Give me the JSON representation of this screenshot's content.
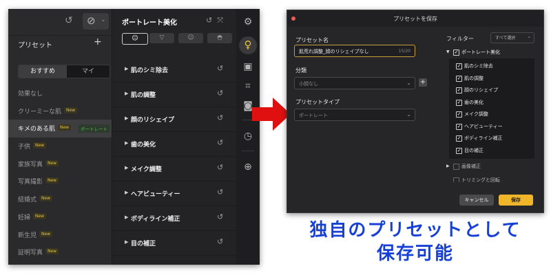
{
  "left_panel": {
    "preset_title": "プリセット",
    "plus": "+",
    "tab_recommended": "おすすめ",
    "tab_mine": "マイ",
    "presets": [
      {
        "label": "効果なし",
        "new": "",
        "tag": ""
      },
      {
        "label": "クリーミーな肌",
        "new": "New",
        "tag": ""
      },
      {
        "label": "キメのある肌",
        "new": "New",
        "tag": "ポートレート"
      },
      {
        "label": "子供",
        "new": "New",
        "tag": ""
      },
      {
        "label": "家族写真",
        "new": "New",
        "tag": ""
      },
      {
        "label": "写真撮影",
        "new": "New",
        "tag": ""
      },
      {
        "label": "結婚式",
        "new": "New",
        "tag": ""
      },
      {
        "label": "妊婦",
        "new": "New",
        "tag": ""
      },
      {
        "label": "新生児",
        "new": "New",
        "tag": ""
      },
      {
        "label": "証明写真",
        "new": "New",
        "tag": ""
      }
    ],
    "selected_index": 2
  },
  "portrait_panel": {
    "title": "ポートレート美化",
    "categories": [
      "肌のシミ除去",
      "肌の調整",
      "顔のリシェイプ",
      "歯の美化",
      "メイク調整",
      "ヘアビューティー",
      "ボディライン補正",
      "目の補正"
    ]
  },
  "toolbar_icons": [
    "sliders-icon",
    "portrait-bulb-icon",
    "photo-icon",
    "crop-icon",
    "camera-icon",
    "history-icon",
    "add-icon"
  ],
  "dialog": {
    "title": "プリセットを保存",
    "name_label": "プリセット名",
    "name_value": "肌荒れ調整_顔のリシェイプなし",
    "name_counter": "15/20",
    "category_label": "分類",
    "category_value": "小顔なし",
    "type_label": "プリセットタイプ",
    "type_value": "ポートレート",
    "filter_label": "フィルター",
    "filter_select": "すべて選択",
    "tree_root": "ポートレート美化",
    "tree_items": [
      "肌のシミ除去",
      "肌の調整",
      "顔のリシェイプ",
      "歯の美化",
      "メイク調整",
      "ヘアビューティー",
      "ボディライン補正",
      "目の補正"
    ],
    "tree_image": "画像補正",
    "tree_crop": "トリミングと回転",
    "cancel": "キャンセル",
    "save": "保存"
  },
  "caption": {
    "line1": "独自のプリセットとして",
    "line2": "保存可能"
  },
  "colors": {
    "accent": "#f0b62a",
    "caption": "#1740d6",
    "arrow": "#e01010",
    "new_badge": "#e1c34a"
  }
}
